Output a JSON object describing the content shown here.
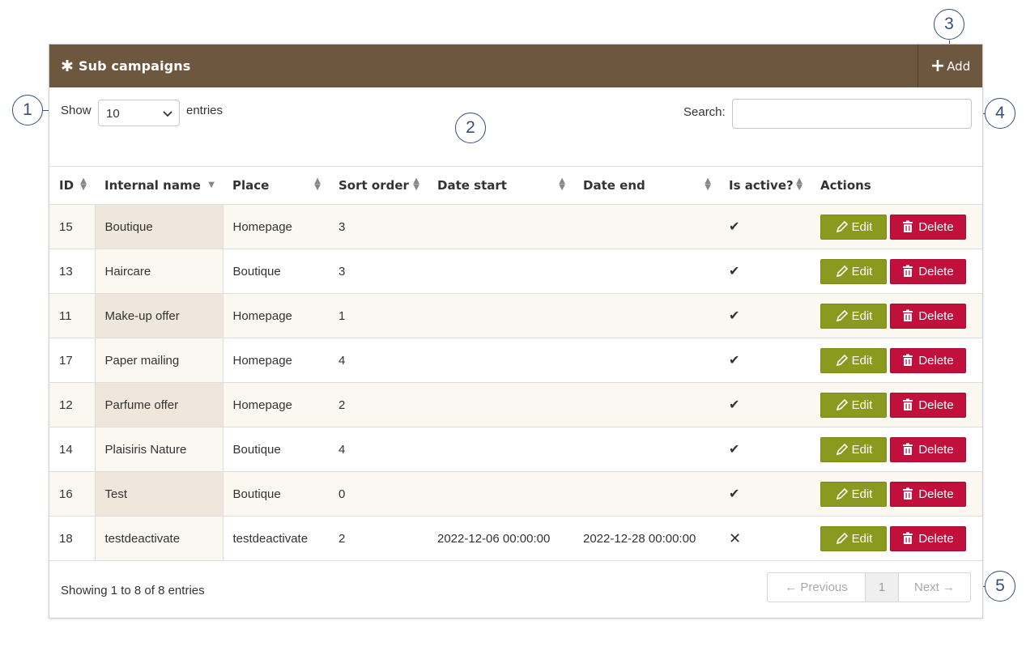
{
  "panel": {
    "title": "Sub campaigns",
    "title_icon": "asterisk-icon",
    "add_label": "Add"
  },
  "length": {
    "show_label": "Show",
    "value": "10",
    "entries_label": "entries"
  },
  "search": {
    "label": "Search:",
    "value": "",
    "placeholder": ""
  },
  "table": {
    "columns": [
      "ID",
      "Internal name",
      "Place",
      "Sort order",
      "Date start",
      "Date end",
      "Is active?",
      "Actions"
    ],
    "rows": [
      {
        "id": "15",
        "name": "Boutique",
        "place": "Homepage",
        "sort": "3",
        "start": "",
        "end": "",
        "active": "✔"
      },
      {
        "id": "13",
        "name": "Haircare",
        "place": "Boutique",
        "sort": "3",
        "start": "",
        "end": "",
        "active": "✔"
      },
      {
        "id": "11",
        "name": "Make-up offer",
        "place": "Homepage",
        "sort": "1",
        "start": "",
        "end": "",
        "active": "✔"
      },
      {
        "id": "17",
        "name": "Paper mailing",
        "place": "Homepage",
        "sort": "4",
        "start": "",
        "end": "",
        "active": "✔"
      },
      {
        "id": "12",
        "name": "Parfume offer",
        "place": "Homepage",
        "sort": "2",
        "start": "",
        "end": "",
        "active": "✔"
      },
      {
        "id": "14",
        "name": "Plaisiris Nature",
        "place": "Boutique",
        "sort": "4",
        "start": "",
        "end": "",
        "active": "✔"
      },
      {
        "id": "16",
        "name": "Test",
        "place": "Boutique",
        "sort": "0",
        "start": "",
        "end": "",
        "active": "✔"
      },
      {
        "id": "18",
        "name": "testdeactivate",
        "place": "testdeactivate",
        "sort": "2",
        "start": "2022-12-06 00:00:00",
        "end": "2022-12-28 00:00:00",
        "active": "✕"
      }
    ],
    "edit_label": "Edit",
    "delete_label": "Delete"
  },
  "footer": {
    "info": "Showing 1 to 8 of 8 entries",
    "prev": "← Previous",
    "page": "1",
    "next": "Next →"
  },
  "callouts": [
    "1",
    "2",
    "3",
    "4",
    "5"
  ],
  "colors": {
    "header": "#6e573f",
    "edit": "#8a9a1f",
    "delete": "#c2103c",
    "callout": "#35507a"
  }
}
